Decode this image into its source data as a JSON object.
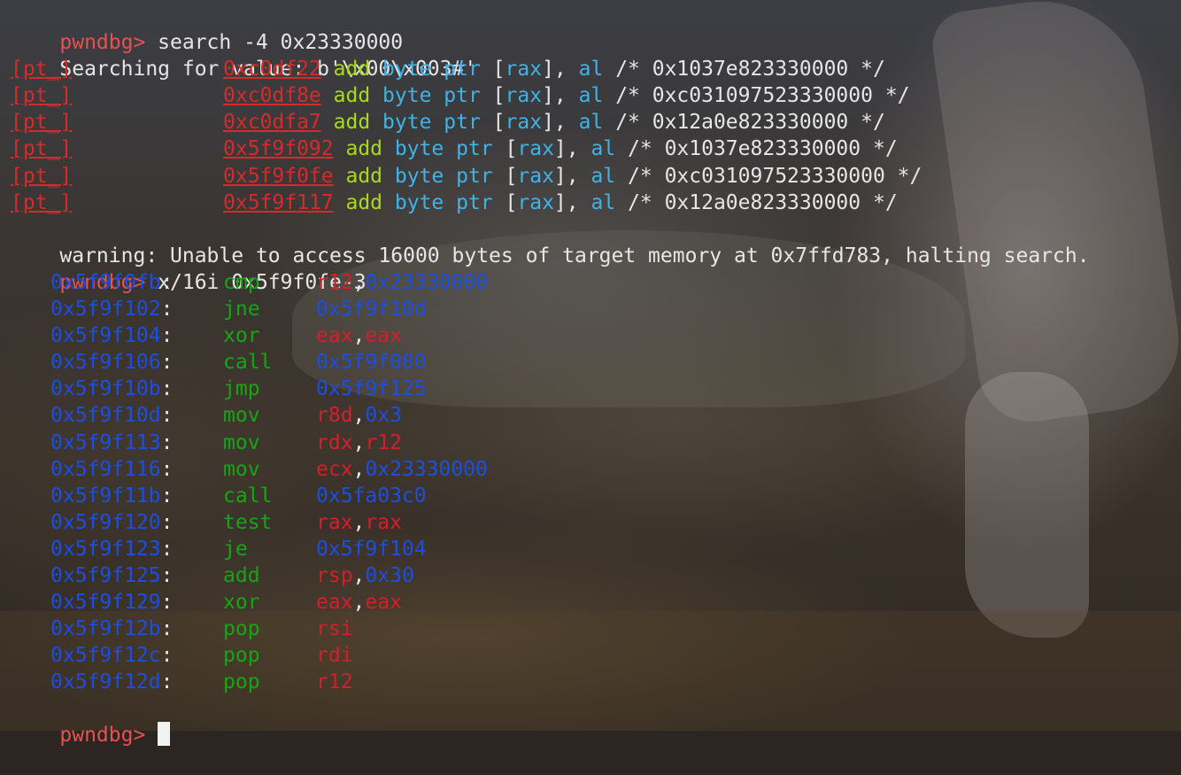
{
  "prompt": "pwndbg> ",
  "commands": {
    "search": "search -4 0x23330000",
    "examine": "x/16i 0x5f9f0fe-3"
  },
  "search_status": "Searching for value: b'\\x00\\x003#'",
  "search_results": [
    {
      "tag": "[pt_]",
      "address": "0xc0df22",
      "instr": "add",
      "size": "byte ptr",
      "reg": "rax",
      "reg2": "al",
      "comment": "/* 0x1037e823330000 */"
    },
    {
      "tag": "[pt_]",
      "address": "0xc0df8e",
      "instr": "add",
      "size": "byte ptr",
      "reg": "rax",
      "reg2": "al",
      "comment": "/* 0xc031097523330000 */"
    },
    {
      "tag": "[pt_]",
      "address": "0xc0dfa7",
      "instr": "add",
      "size": "byte ptr",
      "reg": "rax",
      "reg2": "al",
      "comment": "/* 0x12a0e823330000 */"
    },
    {
      "tag": "[pt_]",
      "address": "0x5f9f092",
      "instr": "add",
      "size": "byte ptr",
      "reg": "rax",
      "reg2": "al",
      "comment": "/* 0x1037e823330000 */"
    },
    {
      "tag": "[pt_]",
      "address": "0x5f9f0fe",
      "instr": "add",
      "size": "byte ptr",
      "reg": "rax",
      "reg2": "al",
      "comment": "/* 0xc031097523330000 */"
    },
    {
      "tag": "[pt_]",
      "address": "0x5f9f117",
      "instr": "add",
      "size": "byte ptr",
      "reg": "rax",
      "reg2": "al",
      "comment": "/* 0x12a0e823330000 */"
    }
  ],
  "warning": "warning: Unable to access 16000 bytes of target memory at 0x7ffd783, halting search.",
  "disassembly": [
    {
      "address": "0x5f9f0fb",
      "mnemonic": "cmp",
      "op1": "r12",
      "op1_kind": "reg",
      "op2": "0x23330000",
      "op2_kind": "imm"
    },
    {
      "address": "0x5f9f102",
      "mnemonic": "jne",
      "op1": "0x5f9f10d",
      "op1_kind": "imm",
      "op2": "",
      "op2_kind": ""
    },
    {
      "address": "0x5f9f104",
      "mnemonic": "xor",
      "op1": "eax",
      "op1_kind": "reg",
      "op2": "eax",
      "op2_kind": "reg"
    },
    {
      "address": "0x5f9f106",
      "mnemonic": "call",
      "op1": "0x5f9f080",
      "op1_kind": "imm",
      "op2": "",
      "op2_kind": ""
    },
    {
      "address": "0x5f9f10b",
      "mnemonic": "jmp",
      "op1": "0x5f9f125",
      "op1_kind": "imm",
      "op2": "",
      "op2_kind": ""
    },
    {
      "address": "0x5f9f10d",
      "mnemonic": "mov",
      "op1": "r8d",
      "op1_kind": "reg",
      "op2": "0x3",
      "op2_kind": "imm"
    },
    {
      "address": "0x5f9f113",
      "mnemonic": "mov",
      "op1": "rdx",
      "op1_kind": "reg",
      "op2": "r12",
      "op2_kind": "reg"
    },
    {
      "address": "0x5f9f116",
      "mnemonic": "mov",
      "op1": "ecx",
      "op1_kind": "reg",
      "op2": "0x23330000",
      "op2_kind": "imm"
    },
    {
      "address": "0x5f9f11b",
      "mnemonic": "call",
      "op1": "0x5fa03c0",
      "op1_kind": "imm",
      "op2": "",
      "op2_kind": ""
    },
    {
      "address": "0x5f9f120",
      "mnemonic": "test",
      "op1": "rax",
      "op1_kind": "reg",
      "op2": "rax",
      "op2_kind": "reg"
    },
    {
      "address": "0x5f9f123",
      "mnemonic": "je",
      "op1": "0x5f9f104",
      "op1_kind": "imm",
      "op2": "",
      "op2_kind": ""
    },
    {
      "address": "0x5f9f125",
      "mnemonic": "add",
      "op1": "rsp",
      "op1_kind": "reg",
      "op2": "0x30",
      "op2_kind": "imm"
    },
    {
      "address": "0x5f9f129",
      "mnemonic": "xor",
      "op1": "eax",
      "op1_kind": "reg",
      "op2": "eax",
      "op2_kind": "reg"
    },
    {
      "address": "0x5f9f12b",
      "mnemonic": "pop",
      "op1": "rsi",
      "op1_kind": "reg",
      "op2": "",
      "op2_kind": ""
    },
    {
      "address": "0x5f9f12c",
      "mnemonic": "pop",
      "op1": "rdi",
      "op1_kind": "reg",
      "op2": "",
      "op2_kind": ""
    },
    {
      "address": "0x5f9f12d",
      "mnemonic": "pop",
      "op1": "r12",
      "op1_kind": "reg",
      "op2": "",
      "op2_kind": ""
    }
  ],
  "colors": {
    "prompt": "#e45252",
    "address_underlined": "#d72a2a",
    "instruction_add": "#a8d91c",
    "operand_keyword": "#3fb3e8",
    "disasm_address": "#1c4fe0",
    "mnemonic": "#14a614",
    "register": "#d41f2a",
    "immediate": "#1c4fe0"
  }
}
